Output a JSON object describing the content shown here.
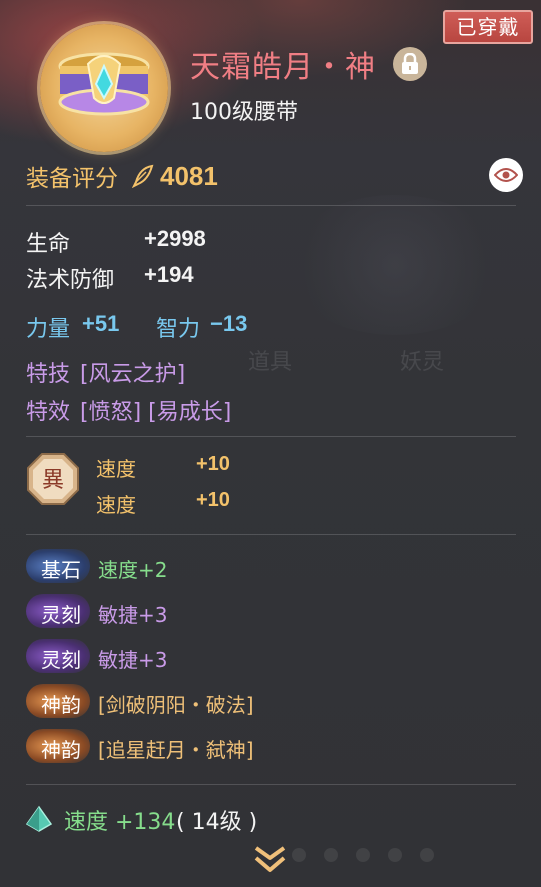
{
  "background": {
    "item_tab": "道具",
    "spirit_tab": "妖灵"
  },
  "badge": "已穿戴",
  "item": {
    "name": "天霜皓月・神",
    "level_type": "100级腰带"
  },
  "score": {
    "label": "装备评分",
    "value": "4081"
  },
  "base_stats": [
    {
      "name": "生命",
      "value": "+2998"
    },
    {
      "name": "法术防御",
      "value": "+194"
    }
  ],
  "attributes": [
    {
      "name": "力量",
      "value": "+51"
    },
    {
      "name": "智力",
      "value": "−13"
    }
  ],
  "skill": {
    "label": "特技",
    "value": "[风云之护]"
  },
  "effect": {
    "label": "特效",
    "values": "[愤怒] [易成长]"
  },
  "rune": {
    "glyph": "異",
    "lines": [
      {
        "name": "速度",
        "value": "+10"
      },
      {
        "name": "速度",
        "value": "+10"
      }
    ]
  },
  "gems": [
    {
      "label": "基石",
      "text": "速度+2",
      "color": "green"
    },
    {
      "label": "灵刻",
      "text": "敏捷+3",
      "color": "purple"
    },
    {
      "label": "灵刻",
      "text": "敏捷+3",
      "color": "purple"
    },
    {
      "label": "神韵",
      "text": "[剑破阴阳・破法]",
      "color": "orange"
    },
    {
      "label": "神韵",
      "text": "[追星赶月・弑神]",
      "color": "orange"
    }
  ],
  "refine": {
    "text": "速度 +134",
    "level": "( 14级 )"
  },
  "colors": {
    "item_name": "#f07e84",
    "score": "#f3c26b",
    "attribute": "#79c8ee",
    "skill": "#c99be8",
    "green": "#86dd8c",
    "badge": "#c14f49"
  },
  "icons": {
    "lock": "lock-icon",
    "eye": "eye-icon",
    "quill": "quill-icon",
    "expand": "chevron-double-down-icon",
    "refine": "crystal-icon"
  }
}
